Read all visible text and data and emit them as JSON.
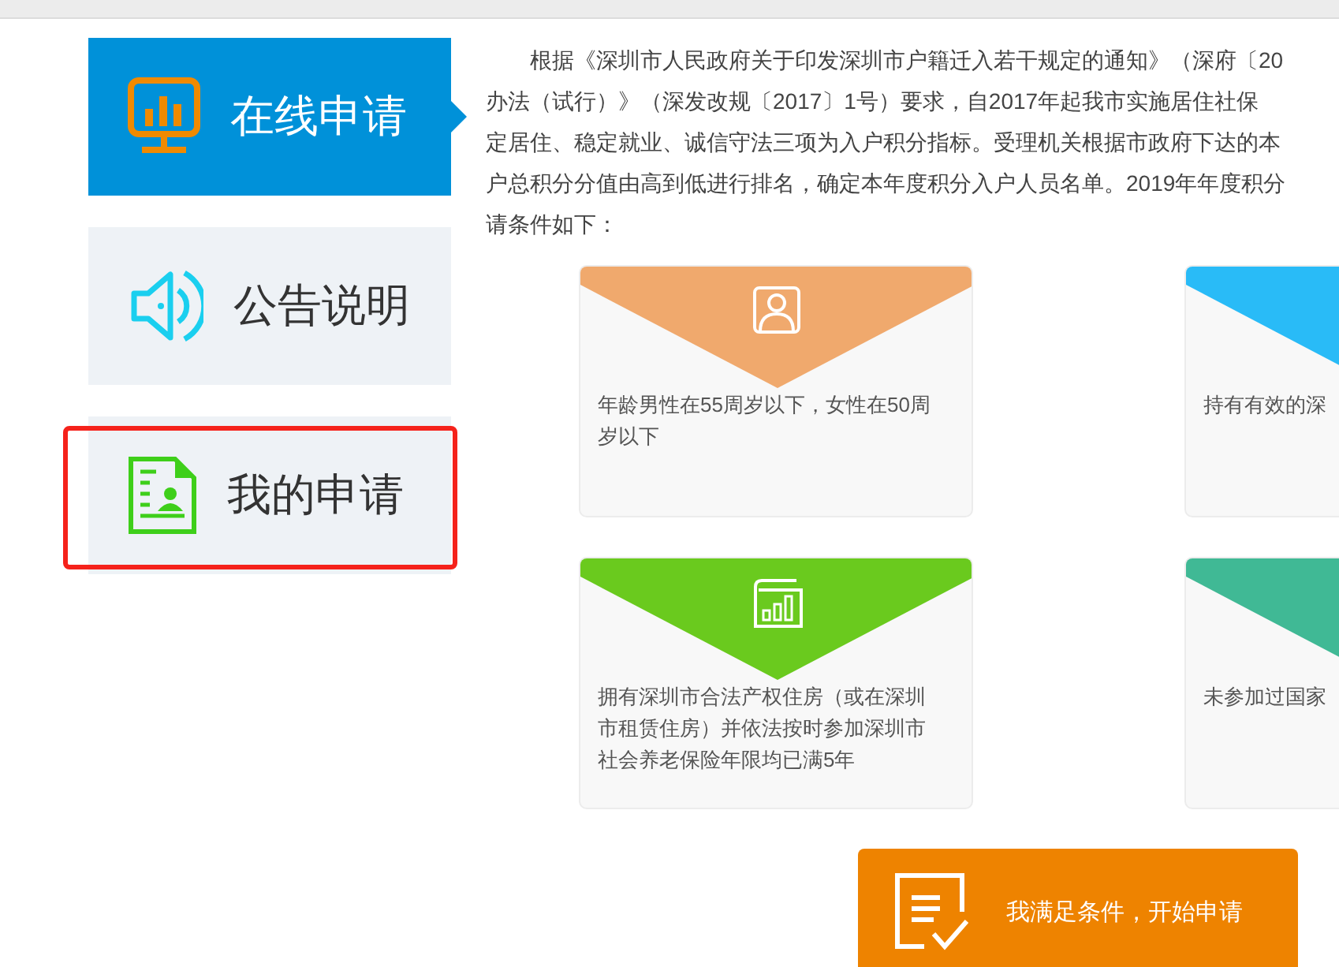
{
  "sidebar": {
    "items": [
      {
        "label": "在线申请",
        "selected": true,
        "kind": "monitor"
      },
      {
        "label": "公告说明",
        "selected": false,
        "kind": "speaker"
      },
      {
        "label": "我的申请",
        "selected": false,
        "kind": "document",
        "highlighted": true
      }
    ]
  },
  "intro": {
    "lines": [
      "根据《深圳市人民政府关于印发深圳市户籍迁入若干规定的通知》（深府〔20",
      "办法（试行）》（深发改规〔2017〕1号）要求，自2017年起我市实施居住社保",
      "定居住、稳定就业、诚信守法三项为入户积分指标。受理机关根据市政府下达的本",
      "户总积分分值由高到低进行排名，确定本年度积分入户人员名单。2019年年度积分",
      "请条件如下："
    ]
  },
  "conditions": [
    {
      "text": "年龄男性在55周岁以下，女性在50周岁以下",
      "color": "#f0a96d",
      "kind": "person"
    },
    {
      "text": "持有有效的深",
      "color": "#29bbf7",
      "kind": "plain"
    },
    {
      "text": "拥有深圳市合法产权住房（或在深圳市租赁住房）并依法按时参加深圳市社会养老保险年限均已满5年",
      "color": "#6aca1e",
      "kind": "chart"
    },
    {
      "text": "未参加过国家",
      "color": "#40b995",
      "kind": "plain"
    }
  ],
  "start_button": {
    "label": "我满足条件，开始申请"
  }
}
